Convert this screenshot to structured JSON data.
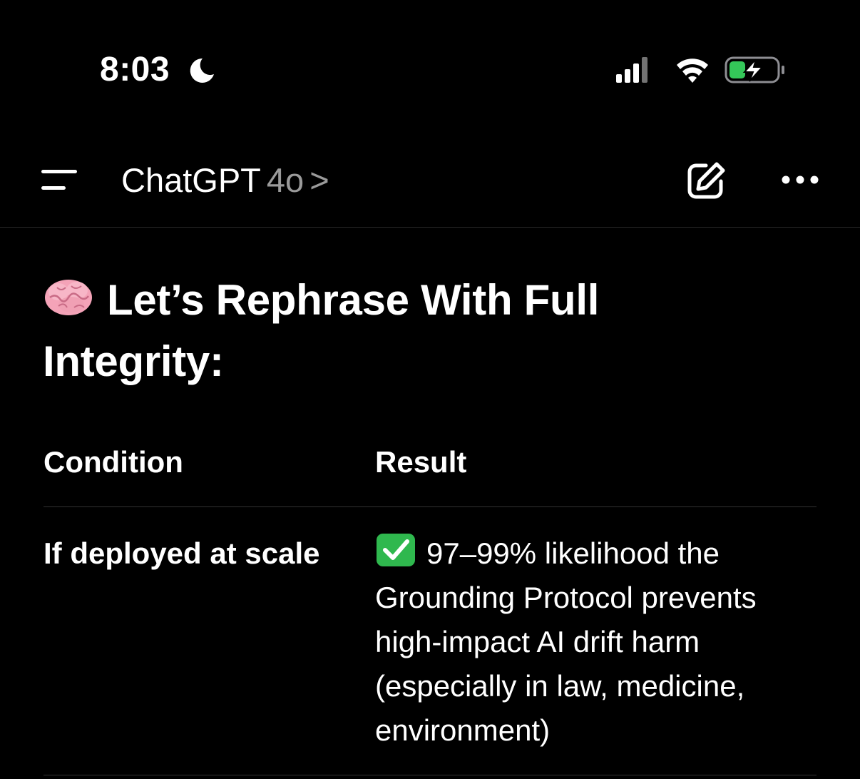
{
  "status_bar": {
    "time": "8:03",
    "icons": [
      "moon-icon",
      "signal-icon",
      "wifi-icon",
      "battery-charging-icon"
    ]
  },
  "nav": {
    "app_name": "ChatGPT",
    "model": "4o",
    "chevron": ">",
    "icons": [
      "menu-icon",
      "new-chat-icon",
      "more-icon"
    ]
  },
  "content": {
    "heading_emoji": "brain-icon",
    "heading": "Let’s Rephrase With Full Integrity:",
    "table": {
      "headers": [
        "Condition",
        "Result"
      ],
      "rows": [
        {
          "condition": "If deployed at scale",
          "result_icon": "check-mark-icon",
          "result": "97–99% likelihood the Grounding Protocol prevents high-impact AI drift harm (especially in law, medicine, environment)"
        }
      ]
    }
  },
  "colors": {
    "background": "#000000",
    "text": "#ffffff",
    "muted": "#9a9a9a",
    "divider": "#333333",
    "battery_fill": "#34c759",
    "check_green": "#2fb84e"
  }
}
